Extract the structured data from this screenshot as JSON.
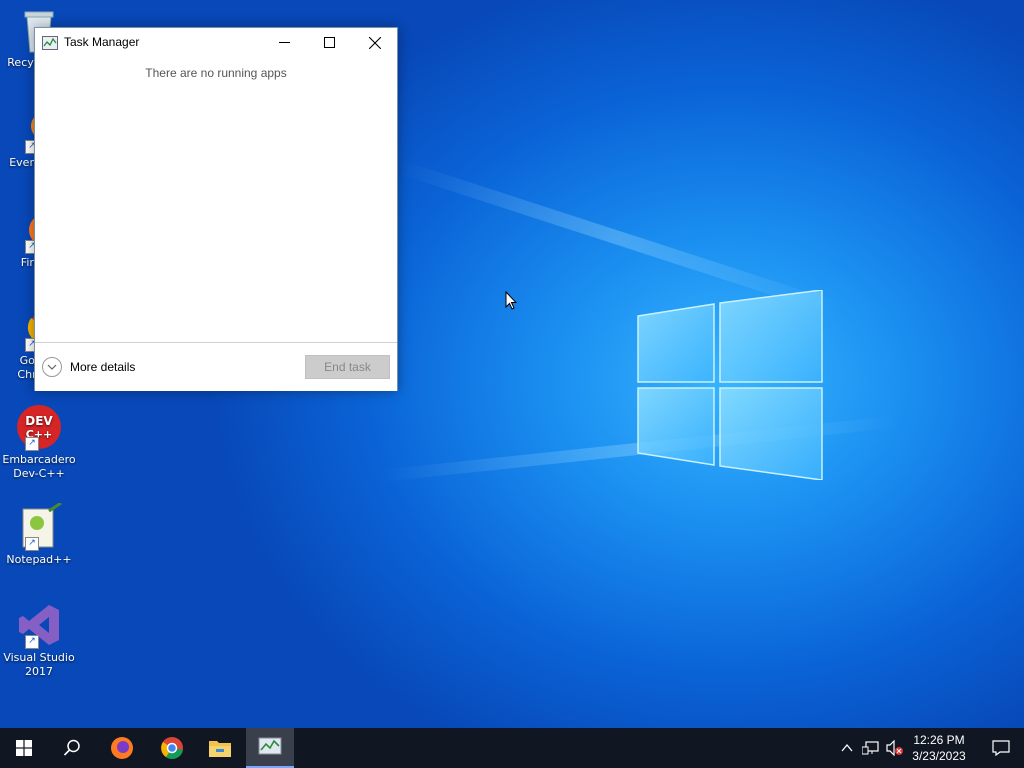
{
  "desktop": {
    "icons": [
      {
        "label": "Recycle Bin"
      },
      {
        "label": "Everything"
      },
      {
        "label": "Firefox"
      },
      {
        "label": "Google Chrome"
      },
      {
        "label": "Embarcadero Dev-C++"
      },
      {
        "label": "Notepad++"
      },
      {
        "label": "Visual Studio 2017"
      }
    ]
  },
  "task_manager": {
    "title": "Task Manager",
    "empty_message": "There are no running apps",
    "more_details_label": "More details",
    "end_task_label": "End task"
  },
  "taskbar": {
    "clock_time": "12:26 PM",
    "clock_date": "3/23/2023",
    "accent_color": "#7aa6ff"
  },
  "colors": {
    "taskbar_bg": "#111722",
    "desktop_blue": "#0a63d6"
  }
}
